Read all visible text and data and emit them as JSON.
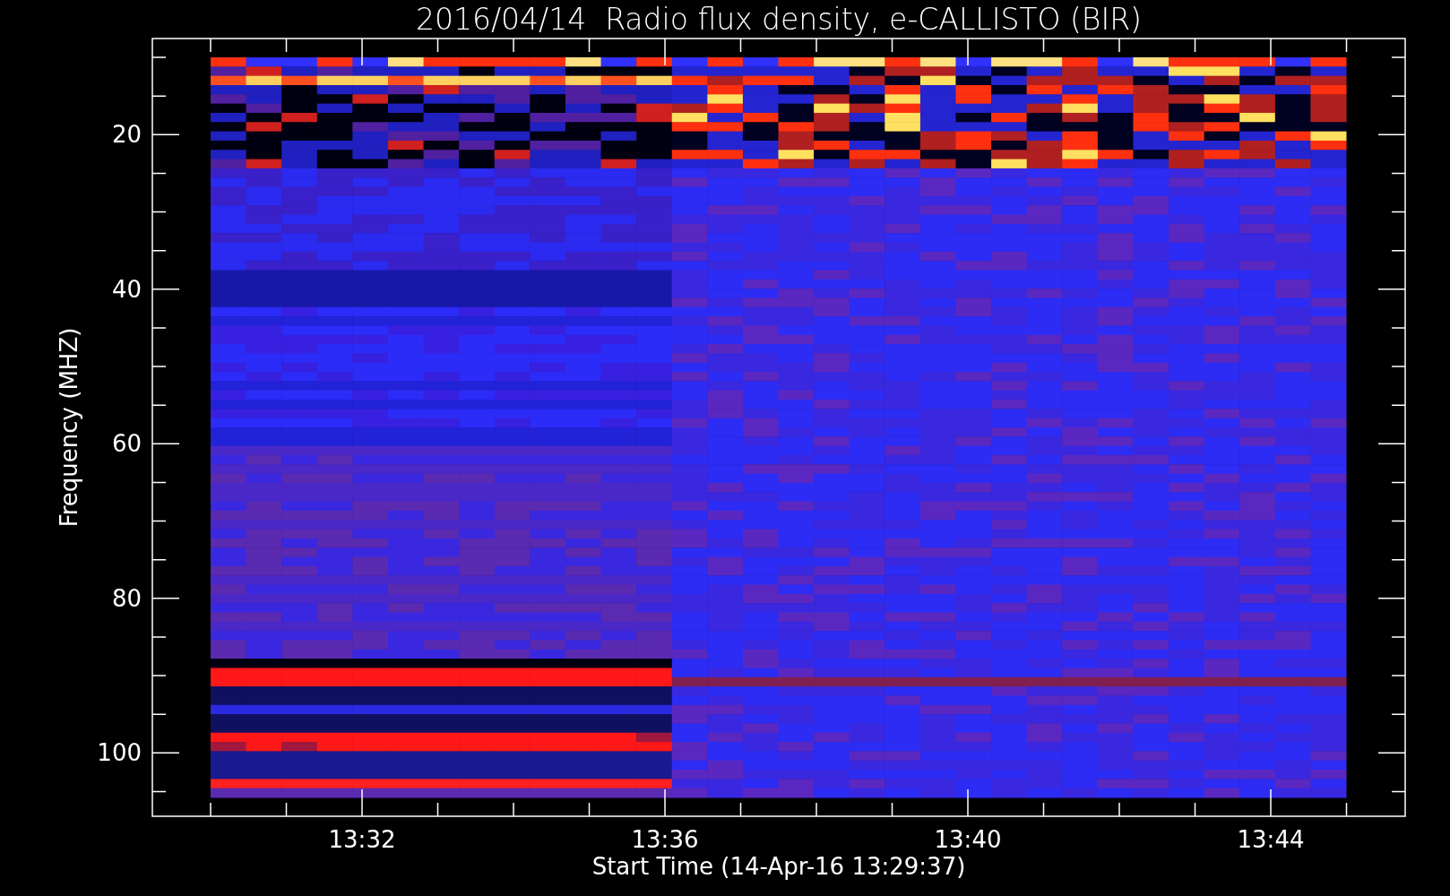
{
  "title": "2016/04/14  Radio flux density, e-CALLISTO (BIR)",
  "y_axis": {
    "label": "Frequency (MHZ)",
    "tick_labels": [
      "20",
      "40",
      "60",
      "80",
      "100"
    ]
  },
  "x_axis": {
    "label": "Start Time (14-Apr-16 13:29:37)",
    "tick_labels": [
      "13:32",
      "13:36",
      "13:40",
      "13:44"
    ]
  }
}
